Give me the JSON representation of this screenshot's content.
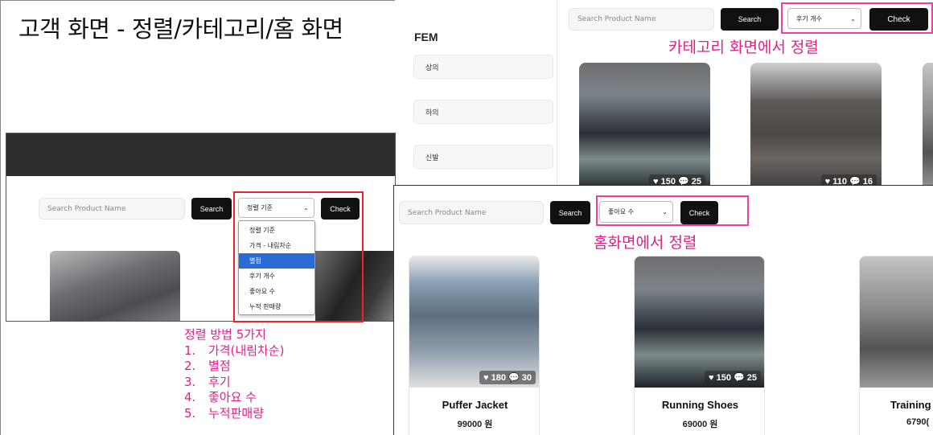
{
  "slide_title": "고객 화면 - 정렬/카테고리/홈 화면",
  "sort_dropdown": {
    "search_placeholder": "Search Product Name",
    "search_label": "Search",
    "selected": "정렬 기준",
    "check_label": "Check",
    "options": [
      {
        "label": "정렬 기준"
      },
      {
        "label": "가격 - 내림차순"
      },
      {
        "label": "별점",
        "highlighted": true
      },
      {
        "label": "후기 개수"
      },
      {
        "label": "좋아요 수"
      },
      {
        "label": "누적 판매량"
      }
    ]
  },
  "sort_methods": {
    "heading": "정렬 방법 5가지",
    "items": [
      {
        "num": "1.",
        "label": "가격(내림차순)"
      },
      {
        "num": "2.",
        "label": "별점"
      },
      {
        "num": "3.",
        "label": "후기"
      },
      {
        "num": "4.",
        "label": "좋아요 수"
      },
      {
        "num": "5.",
        "label": "누적판매량"
      }
    ]
  },
  "category_screen": {
    "search_placeholder": "Search Product Name",
    "search_label": "Search",
    "selected_sort": "후기 개수",
    "check_label": "Check",
    "annotation": "카테고리 화면에서 정렬",
    "category_title": "FEM",
    "categories": [
      "상의",
      "하의",
      "신발"
    ],
    "products": [
      {
        "likes": "150",
        "reviews": "25"
      },
      {
        "likes": "110",
        "reviews": "16"
      }
    ]
  },
  "home_screen": {
    "search_placeholder": "Search Product Name",
    "search_label": "Search",
    "selected_sort": "좋아요 수",
    "check_label": "Check",
    "annotation": "홈화면에서 정렬",
    "products": [
      {
        "name": "Puffer Jacket",
        "price": "99000 원",
        "likes": "180",
        "reviews": "30"
      },
      {
        "name": "Running Shoes",
        "price": "69000 원",
        "likes": "150",
        "reviews": "25"
      },
      {
        "name": "Training",
        "price": "6790("
      }
    ]
  },
  "colors": {
    "annotation_red": "#e8242c",
    "annotation_pink": "#e0208a",
    "highlight_blue": "#2b6bd6"
  }
}
